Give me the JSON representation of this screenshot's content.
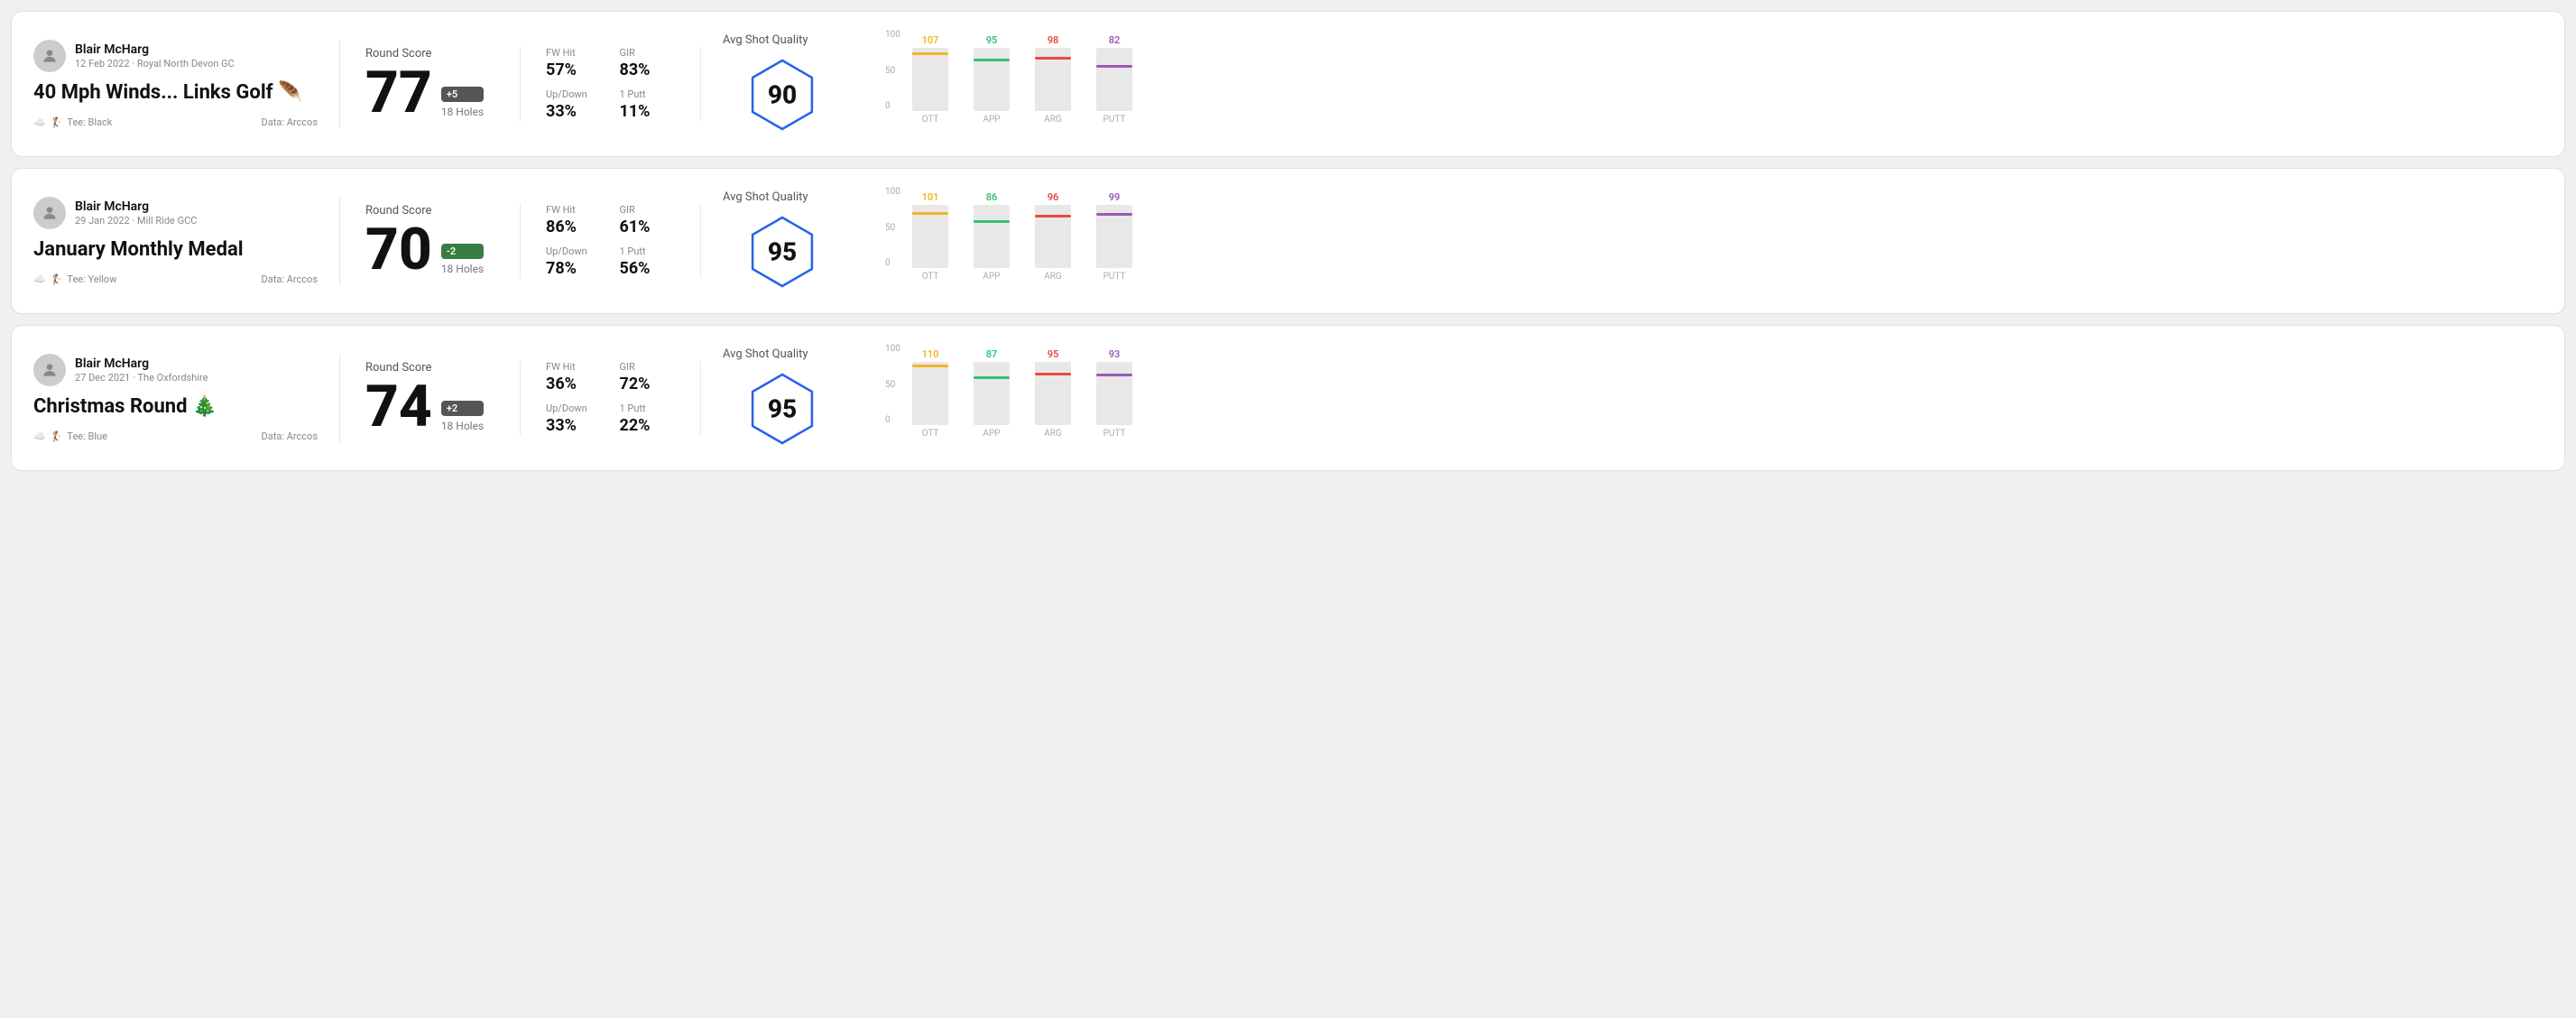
{
  "rounds": [
    {
      "id": "round-1",
      "user": {
        "name": "Blair McHarg",
        "date_course": "12 Feb 2022 · Royal North Devon GC"
      },
      "title": "40 Mph Winds... Links Golf",
      "title_emoji": "🪶",
      "tee": "Black",
      "data_source": "Data: Arccos",
      "score": "77",
      "score_diff": "+5",
      "holes": "18 Holes",
      "fw_hit": "57%",
      "gir": "83%",
      "up_down": "33%",
      "one_putt": "11%",
      "avg_shot_quality": "90",
      "chart": {
        "bars": [
          {
            "label": "OTT",
            "value": 107,
            "color": "#f0b429",
            "height_pct": 65
          },
          {
            "label": "APP",
            "value": 95,
            "color": "#38c172",
            "height_pct": 55
          },
          {
            "label": "ARG",
            "value": 98,
            "color": "#e74c3c",
            "height_pct": 58
          },
          {
            "label": "PUTT",
            "value": 82,
            "color": "#9b59b6",
            "height_pct": 45
          }
        ]
      }
    },
    {
      "id": "round-2",
      "user": {
        "name": "Blair McHarg",
        "date_course": "29 Jan 2022 · Mill Ride GCC"
      },
      "title": "January Monthly Medal",
      "title_emoji": "",
      "tee": "Yellow",
      "data_source": "Data: Arccos",
      "score": "70",
      "score_diff": "-2",
      "holes": "18 Holes",
      "fw_hit": "86%",
      "gir": "61%",
      "up_down": "78%",
      "one_putt": "56%",
      "avg_shot_quality": "95",
      "chart": {
        "bars": [
          {
            "label": "OTT",
            "value": 101,
            "color": "#f0b429",
            "height_pct": 62
          },
          {
            "label": "APP",
            "value": 86,
            "color": "#38c172",
            "height_pct": 48
          },
          {
            "label": "ARG",
            "value": 96,
            "color": "#e74c3c",
            "height_pct": 57
          },
          {
            "label": "PUTT",
            "value": 99,
            "color": "#9b59b6",
            "height_pct": 60
          }
        ]
      }
    },
    {
      "id": "round-3",
      "user": {
        "name": "Blair McHarg",
        "date_course": "27 Dec 2021 · The Oxfordshire"
      },
      "title": "Christmas Round",
      "title_emoji": "🎄",
      "tee": "Blue",
      "data_source": "Data: Arccos",
      "score": "74",
      "score_diff": "+2",
      "holes": "18 Holes",
      "fw_hit": "36%",
      "gir": "72%",
      "up_down": "33%",
      "one_putt": "22%",
      "avg_shot_quality": "95",
      "chart": {
        "bars": [
          {
            "label": "OTT",
            "value": 110,
            "color": "#f0b429",
            "height_pct": 68
          },
          {
            "label": "APP",
            "value": 87,
            "color": "#38c172",
            "height_pct": 49
          },
          {
            "label": "ARG",
            "value": 95,
            "color": "#e74c3c",
            "height_pct": 56
          },
          {
            "label": "PUTT",
            "value": 93,
            "color": "#9b59b6",
            "height_pct": 54
          }
        ]
      }
    }
  ],
  "y_axis_labels": [
    "100",
    "50",
    "0"
  ]
}
